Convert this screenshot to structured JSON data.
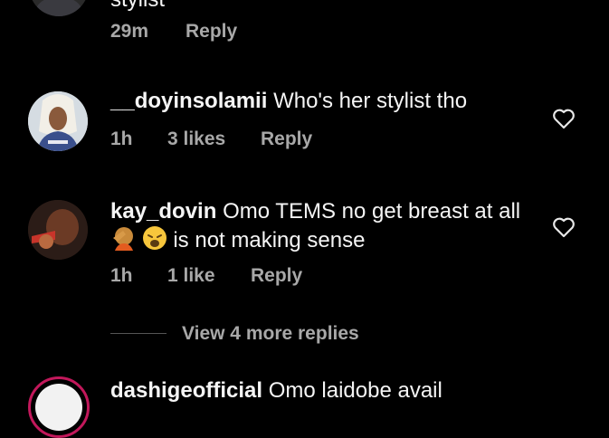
{
  "comments": [
    {
      "partial_text": "stylist",
      "time": "29m",
      "reply_label": "Reply"
    },
    {
      "username": "__doyinsolamii",
      "text": "Who's her stylist tho",
      "time": "1h",
      "likes": "3 likes",
      "reply_label": "Reply",
      "like_icon": "heart-outline-icon"
    },
    {
      "username": "kay_dovin",
      "text": "Omo TEMS no get breast at all",
      "text_after_emoji": "is not making sense",
      "emojis": [
        "person-facepalming",
        "weary-face"
      ],
      "time": "1h",
      "likes": "1 like",
      "reply_label": "Reply",
      "like_icon": "heart-outline-icon",
      "view_replies": "View 4 more replies"
    },
    {
      "username_partial": "dashigeofficial",
      "text_partial": "Omo laidobe avail"
    }
  ],
  "colors": {
    "background": "#000000",
    "primary_text": "#f5f5f5",
    "secondary_text": "#a8a8a8",
    "divider": "#555555"
  }
}
